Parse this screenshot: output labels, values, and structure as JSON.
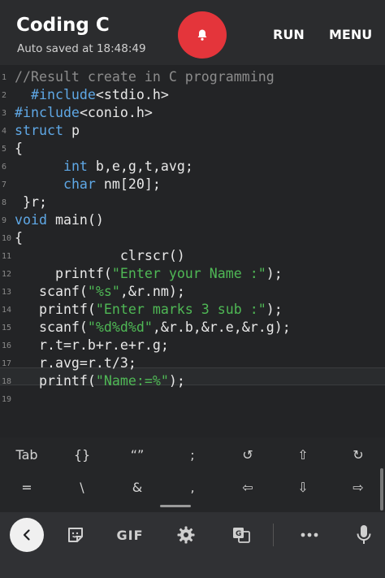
{
  "app": {
    "title": "Coding C",
    "autosave": "Auto saved at 18:48:49",
    "run_label": "RUN",
    "menu_label": "MENU",
    "notify_icon": "bell-icon",
    "accent": "#e4353b"
  },
  "editor": {
    "active_line": 18,
    "lines": [
      {
        "n": "1",
        "segs": [
          {
            "t": "//Result create in C programming",
            "c": "cmt"
          }
        ]
      },
      {
        "n": "2",
        "segs": [
          {
            "t": "  ",
            "c": ""
          },
          {
            "t": "#include",
            "c": "kw"
          },
          {
            "t": "<stdio.h>",
            "c": ""
          }
        ]
      },
      {
        "n": "3",
        "segs": [
          {
            "t": "#include",
            "c": "kw"
          },
          {
            "t": "<conio.h>",
            "c": ""
          }
        ]
      },
      {
        "n": "4",
        "segs": [
          {
            "t": "struct",
            "c": "kw"
          },
          {
            "t": " p",
            "c": ""
          }
        ]
      },
      {
        "n": "5",
        "segs": [
          {
            "t": "{",
            "c": ""
          }
        ]
      },
      {
        "n": "6",
        "segs": [
          {
            "t": "      ",
            "c": ""
          },
          {
            "t": "int",
            "c": "kw"
          },
          {
            "t": " b,e,g,t,avg;",
            "c": ""
          }
        ]
      },
      {
        "n": "7",
        "segs": [
          {
            "t": "      ",
            "c": ""
          },
          {
            "t": "char",
            "c": "kw"
          },
          {
            "t": " nm[20];",
            "c": ""
          }
        ]
      },
      {
        "n": "8",
        "segs": [
          {
            "t": " }r;",
            "c": ""
          }
        ]
      },
      {
        "n": "9",
        "segs": [
          {
            "t": "void",
            "c": "kw"
          },
          {
            "t": " main()",
            "c": ""
          }
        ]
      },
      {
        "n": "10",
        "segs": [
          {
            "t": "{",
            "c": ""
          }
        ]
      },
      {
        "n": "11",
        "segs": [
          {
            "t": "             clrscr()",
            "c": ""
          }
        ]
      },
      {
        "n": "12",
        "segs": [
          {
            "t": "     printf(",
            "c": ""
          },
          {
            "t": "\"Enter your Name :\"",
            "c": "str"
          },
          {
            "t": ");",
            "c": ""
          }
        ]
      },
      {
        "n": "13",
        "segs": [
          {
            "t": "   scanf(",
            "c": ""
          },
          {
            "t": "\"%s\"",
            "c": "str"
          },
          {
            "t": ",&r.nm);",
            "c": ""
          }
        ]
      },
      {
        "n": "14",
        "segs": [
          {
            "t": "   printf(",
            "c": ""
          },
          {
            "t": "\"Enter marks 3 sub :\"",
            "c": "str"
          },
          {
            "t": ");",
            "c": ""
          }
        ]
      },
      {
        "n": "15",
        "segs": [
          {
            "t": "   scanf(",
            "c": ""
          },
          {
            "t": "\"%d%d%d\"",
            "c": "str"
          },
          {
            "t": ",&r.b,&r.e,&r.g);",
            "c": ""
          }
        ]
      },
      {
        "n": "16",
        "segs": [
          {
            "t": "   r.t=r.b+r.e+r.g;",
            "c": ""
          }
        ]
      },
      {
        "n": "17",
        "segs": [
          {
            "t": "   r.avg=r.t/3;",
            "c": ""
          }
        ]
      },
      {
        "n": "18",
        "segs": [
          {
            "t": "   printf(",
            "c": ""
          },
          {
            "t": "\"Name:=%\"",
            "c": "str"
          },
          {
            "t": ");",
            "c": ""
          }
        ]
      },
      {
        "n": "19",
        "segs": []
      }
    ]
  },
  "extra_keys": {
    "row1": [
      "Tab",
      "{}",
      "“”",
      ";",
      "↺",
      "⇧",
      "↻"
    ],
    "row2": [
      "=",
      "\\",
      "&",
      ",",
      "⇦",
      "⇩",
      "⇨"
    ]
  },
  "keyboard_bar": {
    "gif_label": "GIF",
    "icons": [
      "back-chevron-icon",
      "sticker-icon",
      "gif-icon",
      "gear-icon",
      "translate-icon",
      "more-icon",
      "mic-icon"
    ]
  }
}
